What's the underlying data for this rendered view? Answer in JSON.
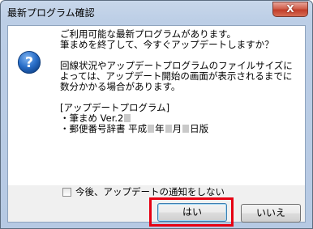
{
  "window": {
    "title": "最新プログラム確認",
    "close_label": "X"
  },
  "message": {
    "p1": "ご利用可能な最新プログラムがあります。\n筆まめを終了して、今すぐアップデートしますか？",
    "p2": "回線状況やアップデートプログラムのファイルサイズによっては、アップデート開始の画面が表示されるまでに数分かかる場合があります。",
    "list_header": "[アップデートプログラム]",
    "item1_prefix": "・筆まめ Ver.2",
    "item2_prefix": "・郵便番号辞書 平成",
    "item2_year_suffix": "年",
    "item2_month_suffix": "月",
    "item2_day_suffix": "日版"
  },
  "checkbox": {
    "label": "今後、アップデートの通知をしない",
    "checked": false
  },
  "buttons": {
    "yes": "はい",
    "no": "いいえ"
  },
  "colors": {
    "highlight": "#e60012",
    "info_icon": "#1f5fb0"
  }
}
